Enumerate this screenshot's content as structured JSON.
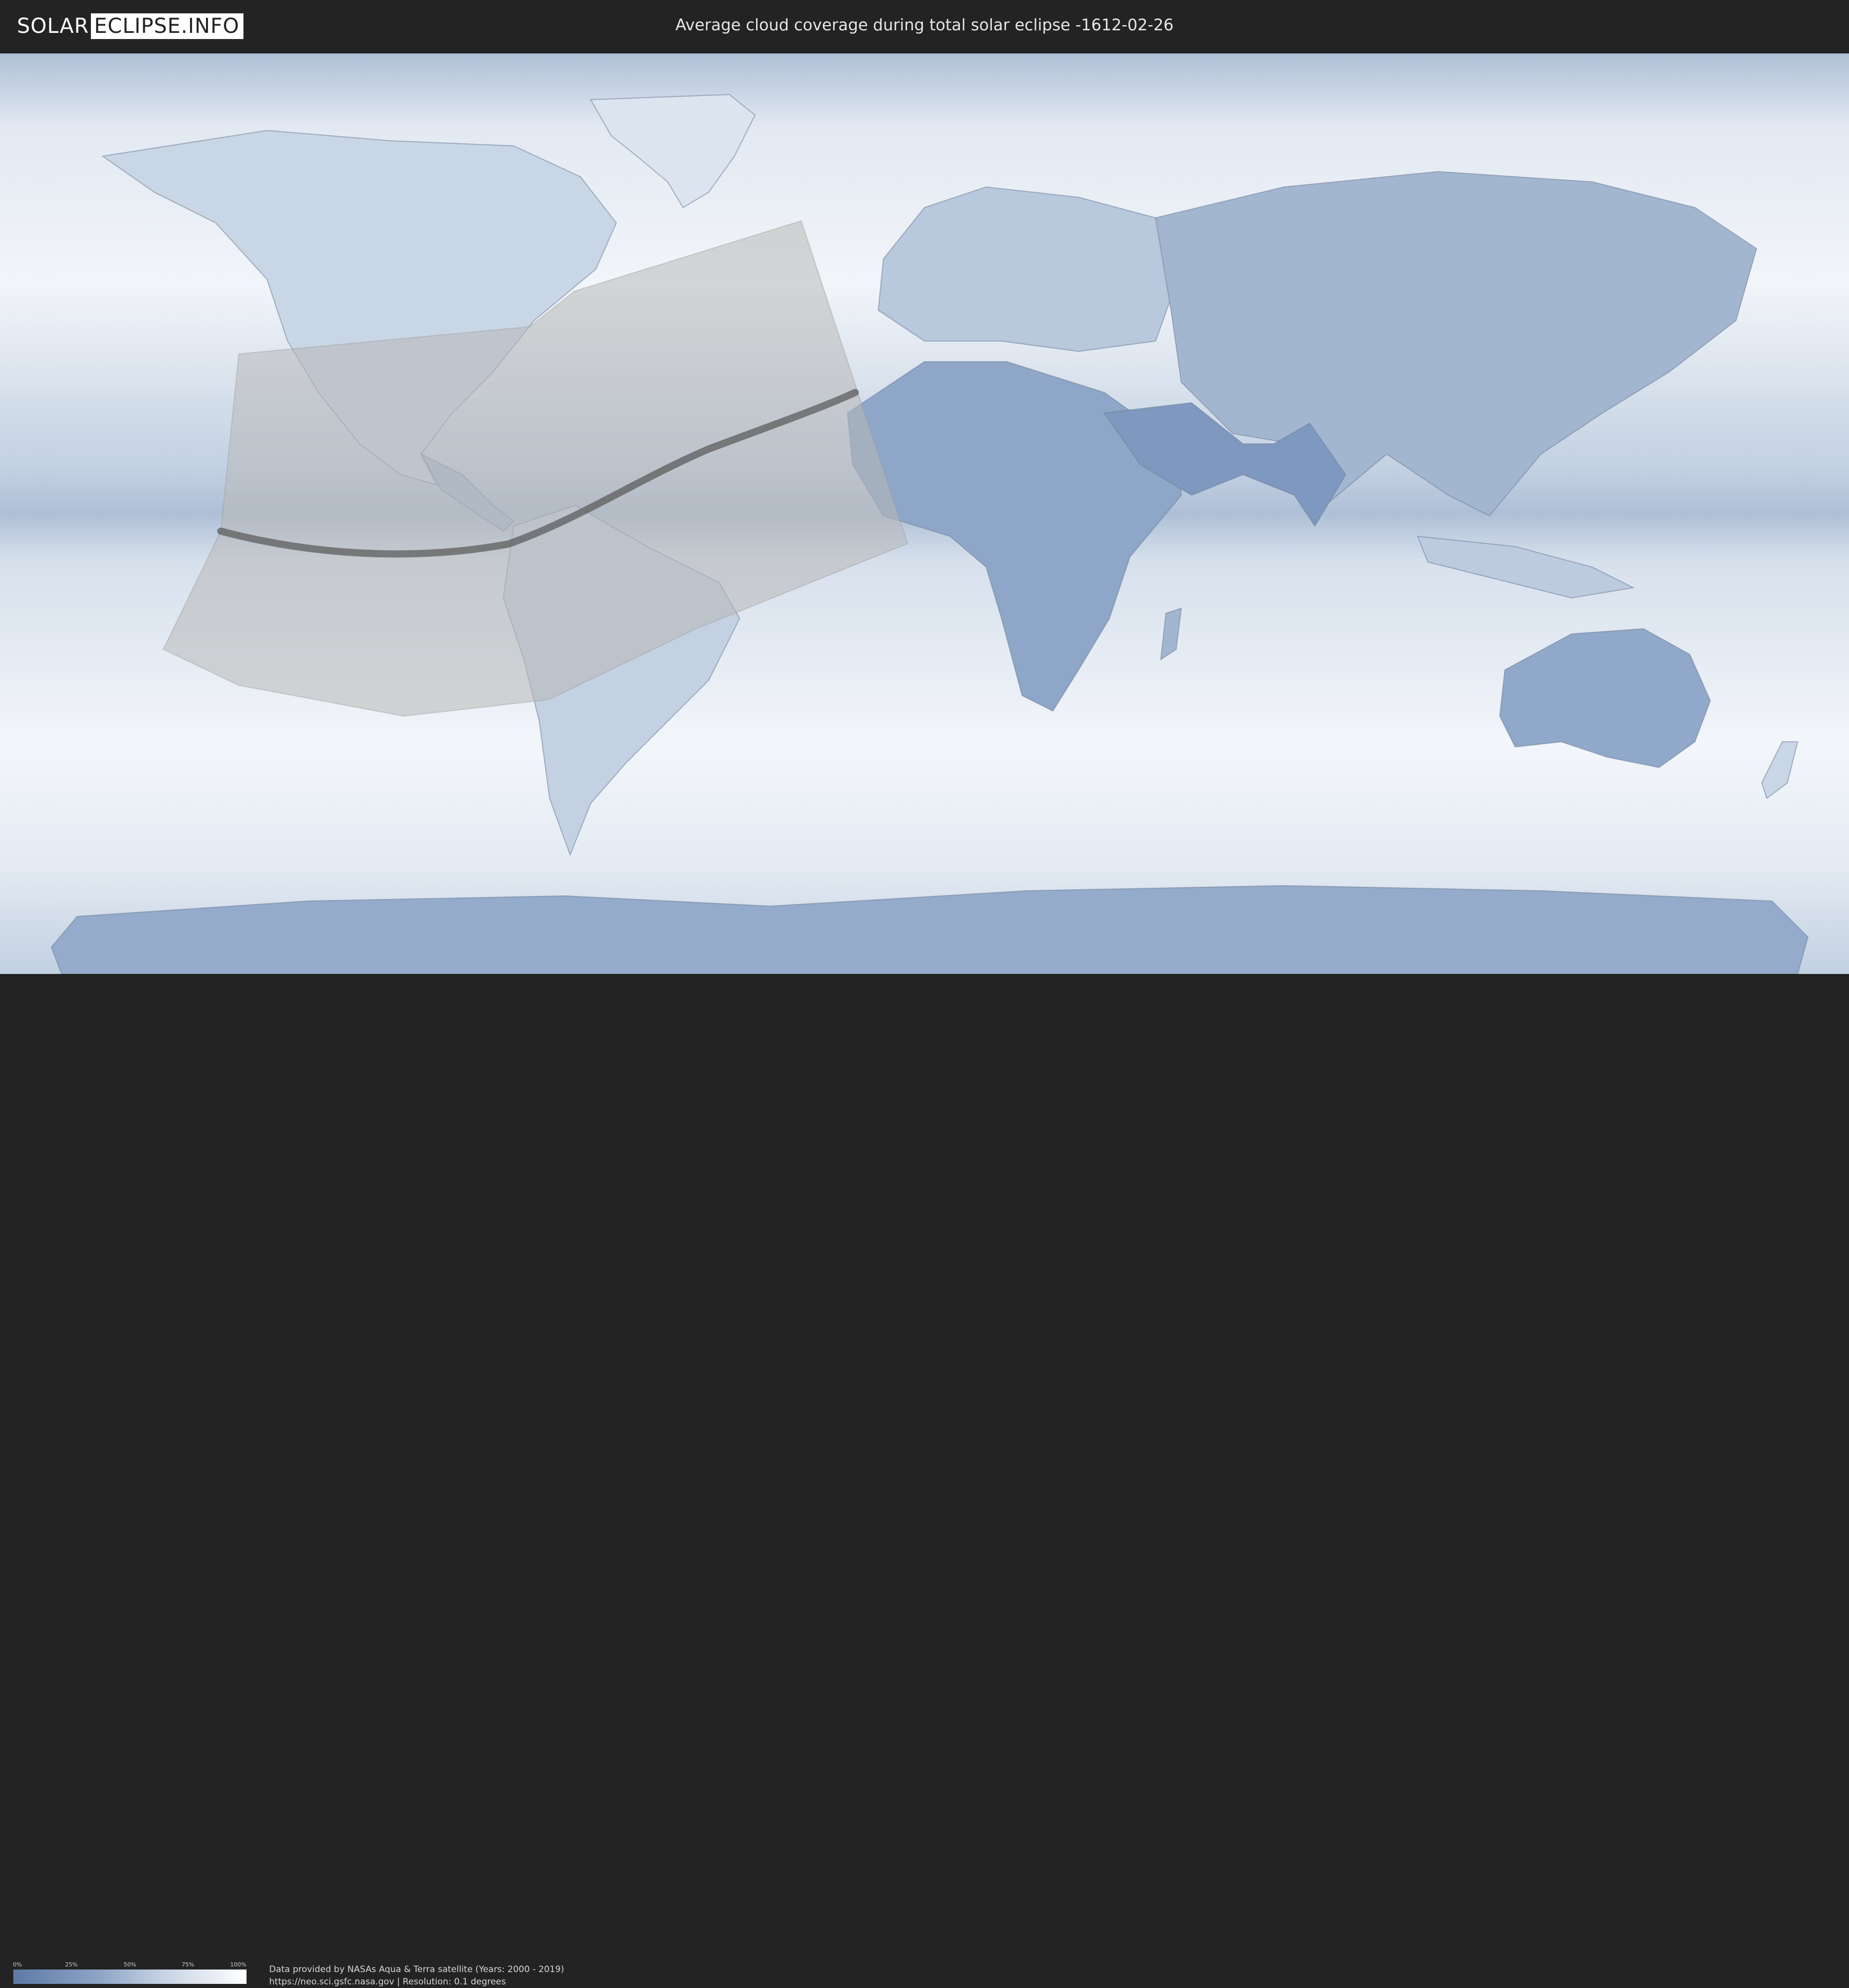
{
  "header": {
    "logo_part1": "SOLAR",
    "logo_part2": "ECLIPSE.INFO",
    "title": "Average cloud coverage during total solar eclipse -1612-02-26"
  },
  "map": {
    "ocean_color": "#b9c7d8",
    "cloud_color": "#f4f7fb",
    "land_color": "#6f8bb4",
    "visibility_zone_color": "#b8b8b8",
    "totality_path_color": "#555555"
  },
  "legend": {
    "ticks": [
      "0%",
      "25%",
      "50%",
      "75%",
      "100%"
    ],
    "gradient_start": "#5d7aa6",
    "gradient_end": "#ffffff"
  },
  "credits": {
    "line1": "Data provided by NASAs Aqua & Terra satellite (Years: 2000 - 2019)",
    "line2": "https://neo.sci.gsfc.nasa.gov | Resolution: 0.1 degrees"
  }
}
